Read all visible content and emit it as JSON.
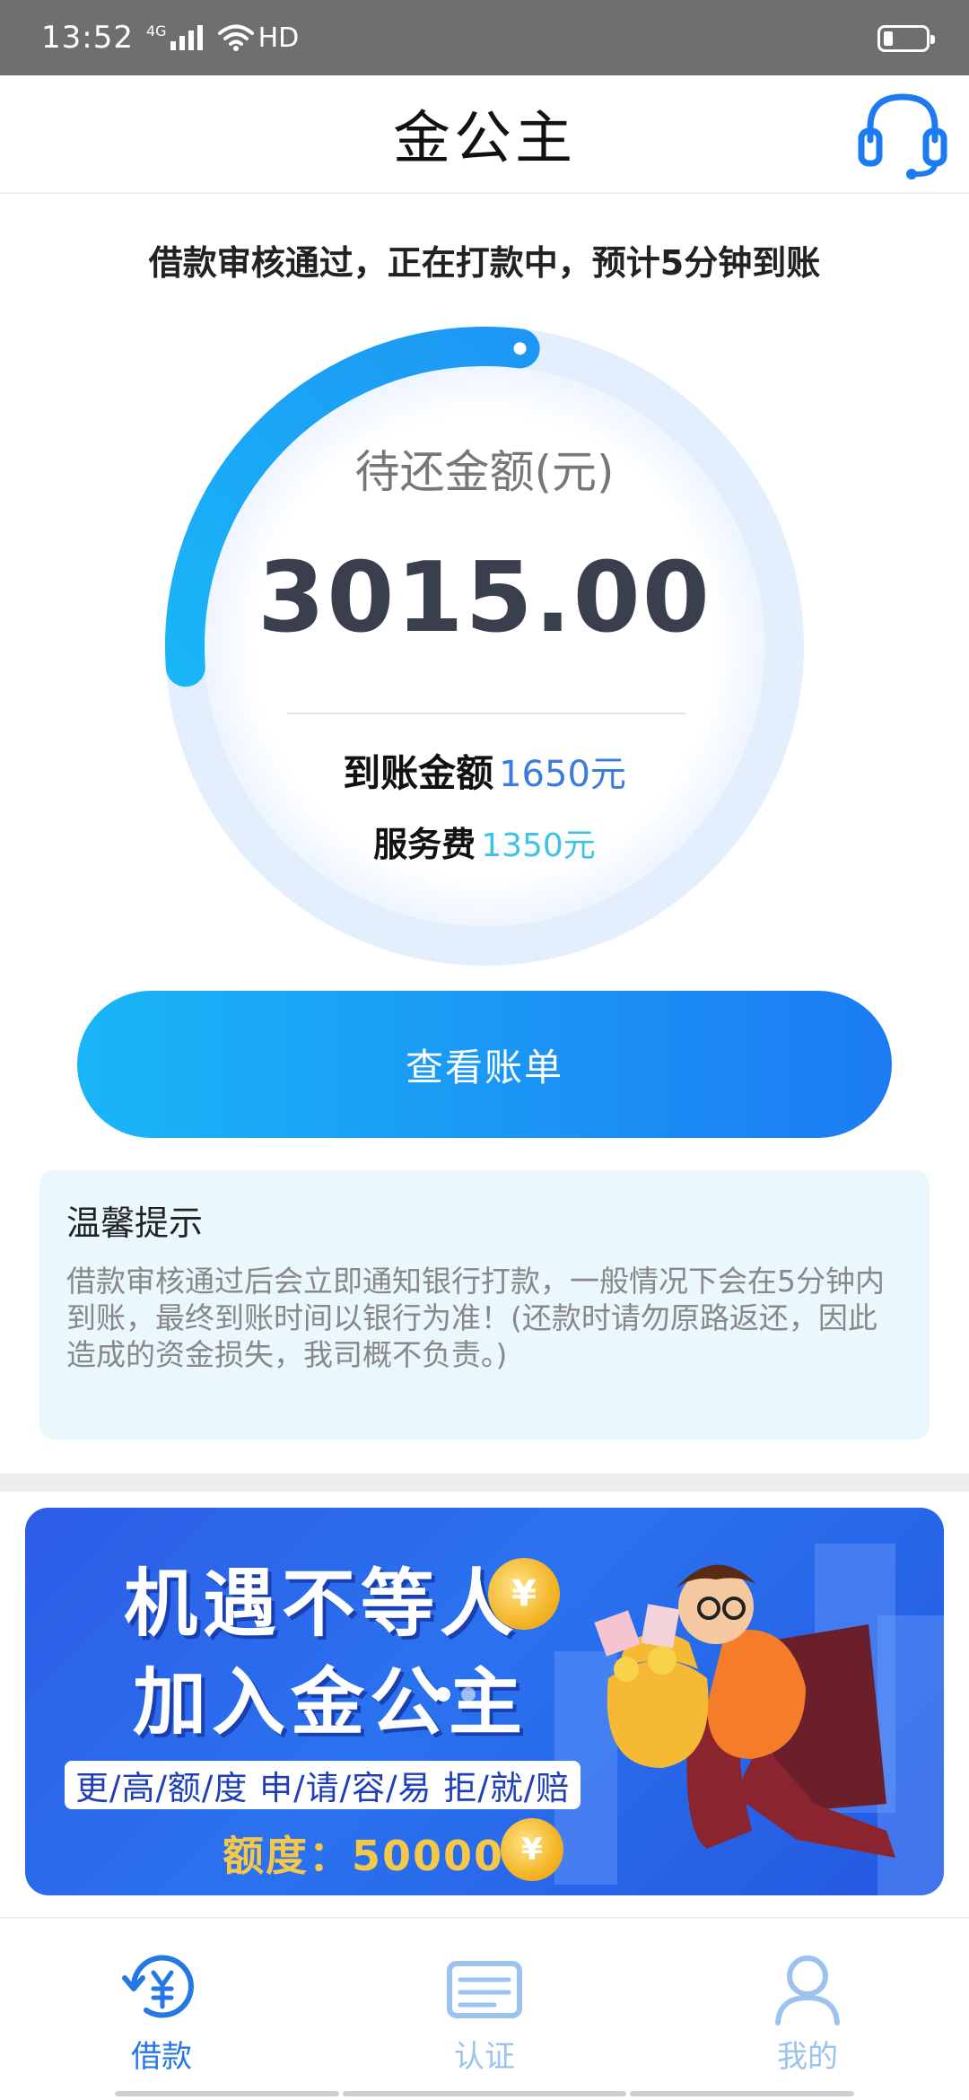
{
  "status_bar": {
    "time": "13:52",
    "network": "4G",
    "hd": "HD"
  },
  "header": {
    "title": "金公主",
    "support_icon": "headset-icon"
  },
  "notice": "借款审核通过，正在打款中，预计5分钟到账",
  "progress_ring": {
    "fraction_filled": 0.28,
    "label": "待还金额(元)",
    "amount": "3015.00",
    "received_label": "到账金额",
    "received_value": "1650元",
    "fee_label": "服务费",
    "fee_value": "1350元"
  },
  "main_button": {
    "label": "查看账单"
  },
  "tips": {
    "title": "温馨提示",
    "body": "借款审核通过后会立即通知银行打款，一般情况下会在5分钟内到账，最终到账时间以银行为准！(还款时请勿原路返还，因此造成的资金损失，我司概不负责。)"
  },
  "banner": {
    "line1": "机遇不等人",
    "line2": "加入金公主",
    "features": "更/高/额/度 申/请/容/易 拒/就/赔",
    "quota": "额度：50000"
  },
  "bottom_nav": [
    {
      "label": "借款",
      "icon": "loan-yen-icon",
      "active": true
    },
    {
      "label": "认证",
      "icon": "id-card-icon",
      "active": false
    },
    {
      "label": "我的",
      "icon": "user-icon",
      "active": false
    }
  ],
  "colors": {
    "accent": "#1c7bf3",
    "accent_light": "#19b6f7",
    "received_value": "#3b7be0",
    "fee_value": "#3fc3e2",
    "tips_bg": "#eaf7fd",
    "ring_track": "#e3effd"
  }
}
